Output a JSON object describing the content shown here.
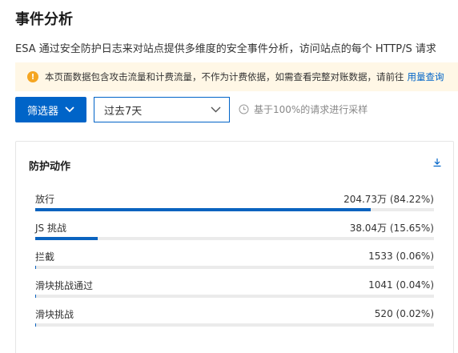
{
  "page": {
    "title": "事件分析",
    "description": "ESA 通过安全防护日志来对站点提供多维度的安全事件分析，访问站点的每个 HTTP/S 请求",
    "notice": {
      "icon": "warning-icon",
      "text": "本页面数据包含攻击流量和计费流量，不作为计费依据，如需查看完整对账数据，请前往",
      "link_label": "用量查询"
    }
  },
  "toolbar": {
    "filter_label": "筛选器",
    "range_value": "过去7天",
    "sampling_text": "基于100%的请求进行采样"
  },
  "card": {
    "title": "防护动作",
    "download_icon": "download-icon",
    "rows": [
      {
        "label": "放行",
        "value": "204.73万 (84.22%)",
        "percent": 84.22
      },
      {
        "label": "JS 挑战",
        "value": "38.04万 (15.65%)",
        "percent": 15.65
      },
      {
        "label": "拦截",
        "value": "1533 (0.06%)",
        "percent": 0.06
      },
      {
        "label": "滑块挑战通过",
        "value": "1041 (0.04%)",
        "percent": 0.04
      },
      {
        "label": "滑块挑战",
        "value": "520 (0.02%)",
        "percent": 0.02
      }
    ]
  },
  "colors": {
    "primary": "#0064c8",
    "bar_fill": "#0a63bf",
    "bar_track": "#ebebeb",
    "notice_bg": "#fff7e6",
    "warning": "#f5a623"
  }
}
